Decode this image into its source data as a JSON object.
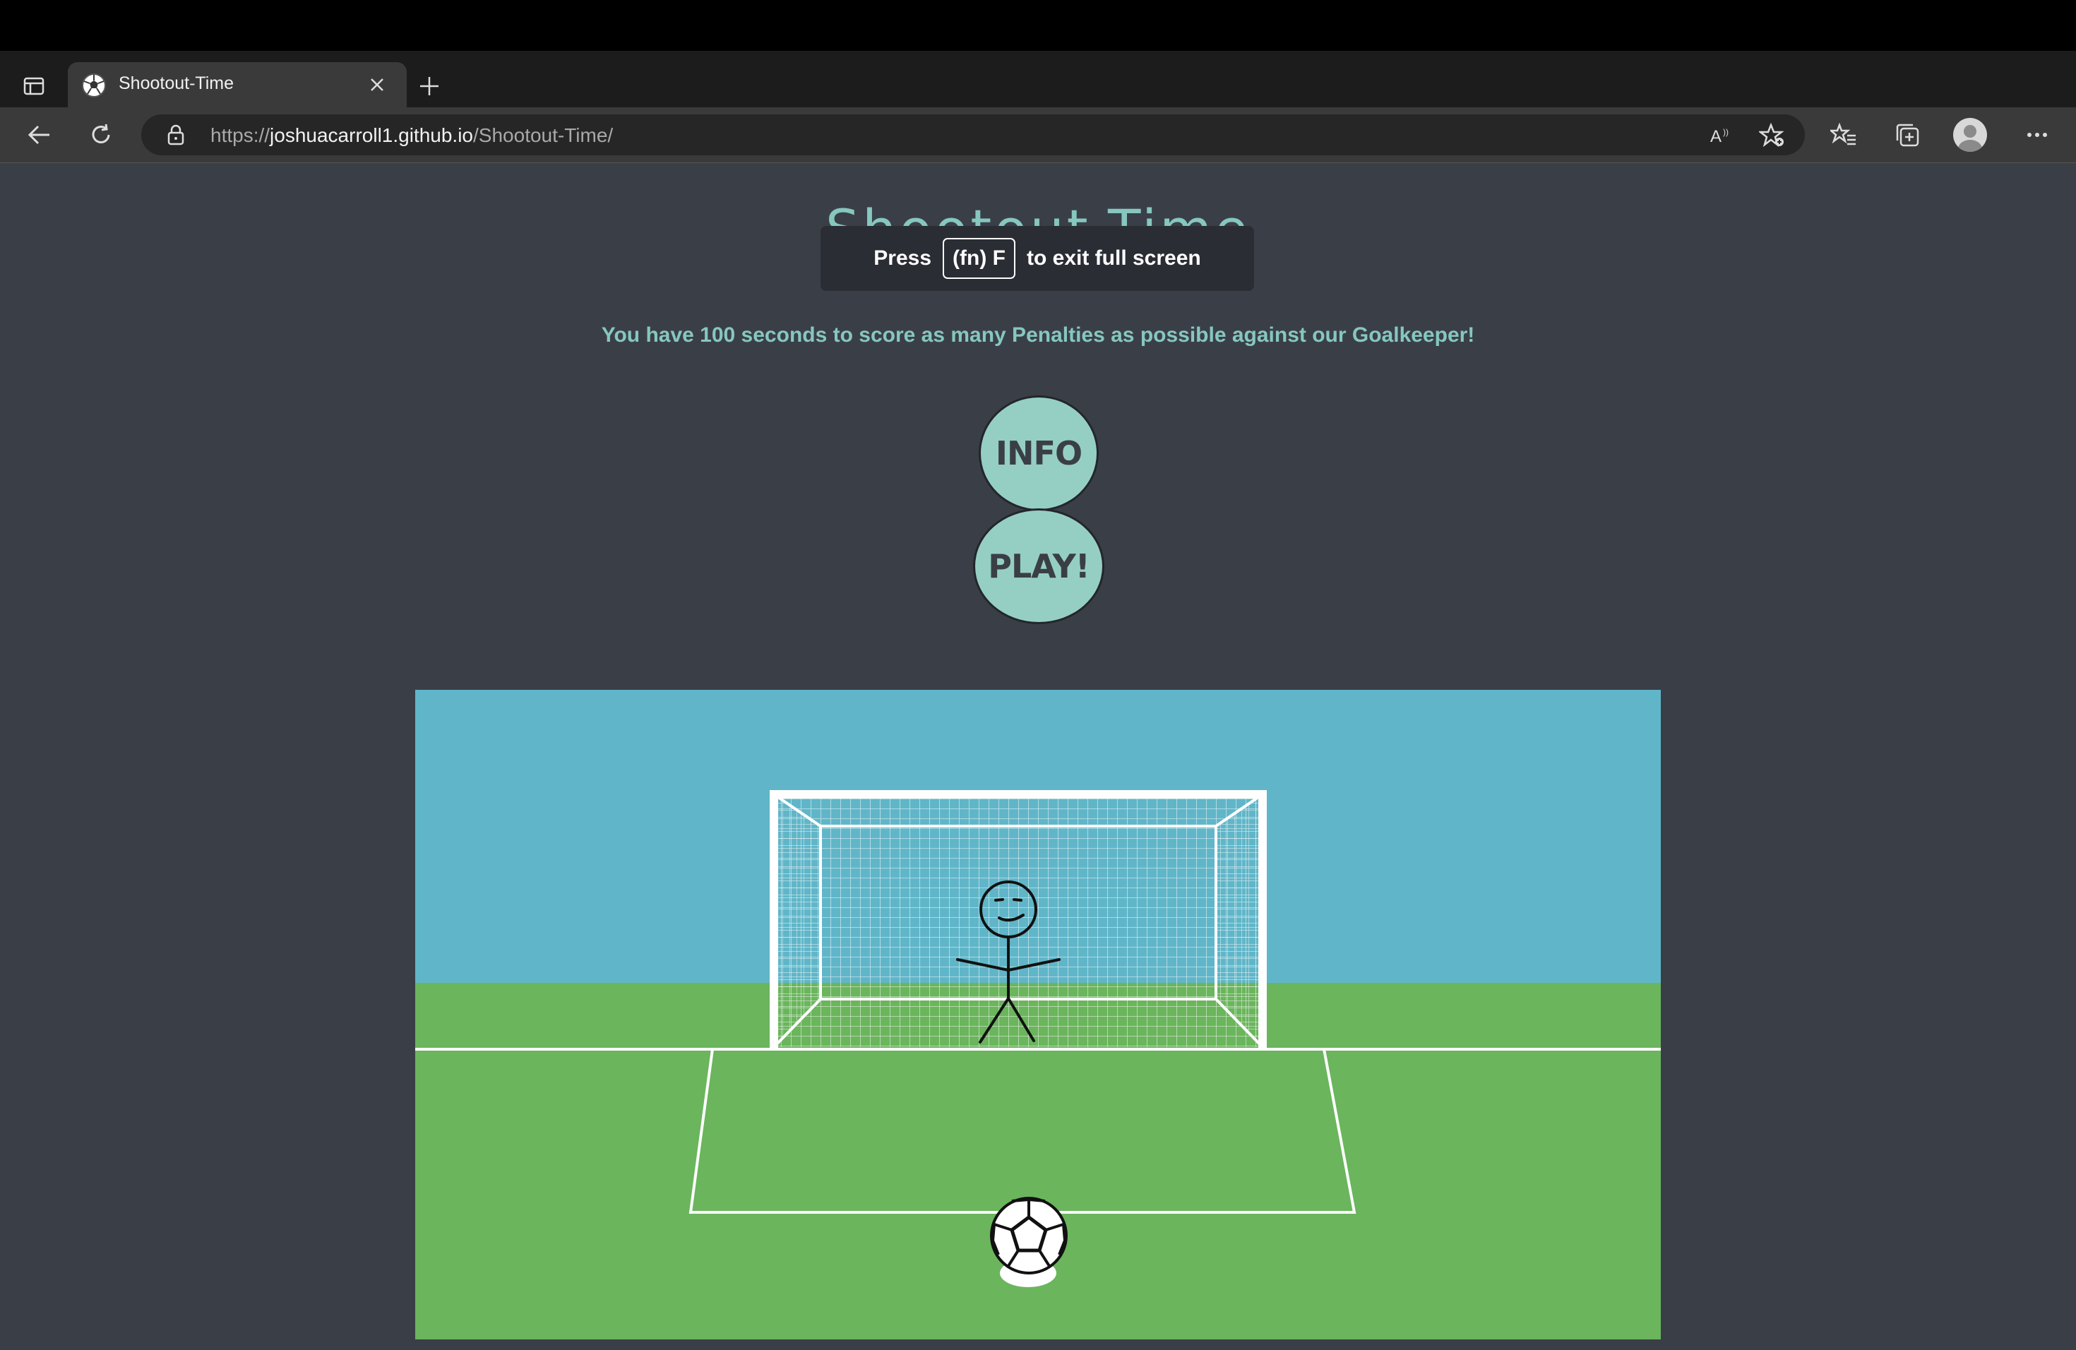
{
  "browser": {
    "tab": {
      "title": "Shootout-Time"
    },
    "address": {
      "scheme": "https://",
      "host": "joshuacarroll1.github.io",
      "path": "/Shootout-Time/"
    },
    "icons": {
      "tab_actions": "tab-actions-icon",
      "favicon": "soccer-ball-favicon",
      "close": "close-icon",
      "new_tab": "plus-icon",
      "back": "back-arrow-icon",
      "refresh": "refresh-icon",
      "lock": "lock-icon",
      "read_aloud": "read-aloud-icon",
      "add_favorite": "add-favorite-icon",
      "favorites": "favorites-icon",
      "collections": "collections-icon",
      "profile": "avatar",
      "menu": "more-icon"
    }
  },
  "page": {
    "title": "Shootout-Time",
    "fullscreen_notice": {
      "press": "Press",
      "key": "(fn) F",
      "rest": "to exit full screen"
    },
    "subtitle": "You have 100 seconds to score as many Penalties as possible against our Goalkeeper!",
    "buttons": {
      "info": "INFO",
      "play": "PLAY!"
    }
  },
  "colors": {
    "background": "#3a3f47",
    "accent": "#95cfc4",
    "sky": "#60b6c8",
    "grass": "#6bb55d"
  }
}
